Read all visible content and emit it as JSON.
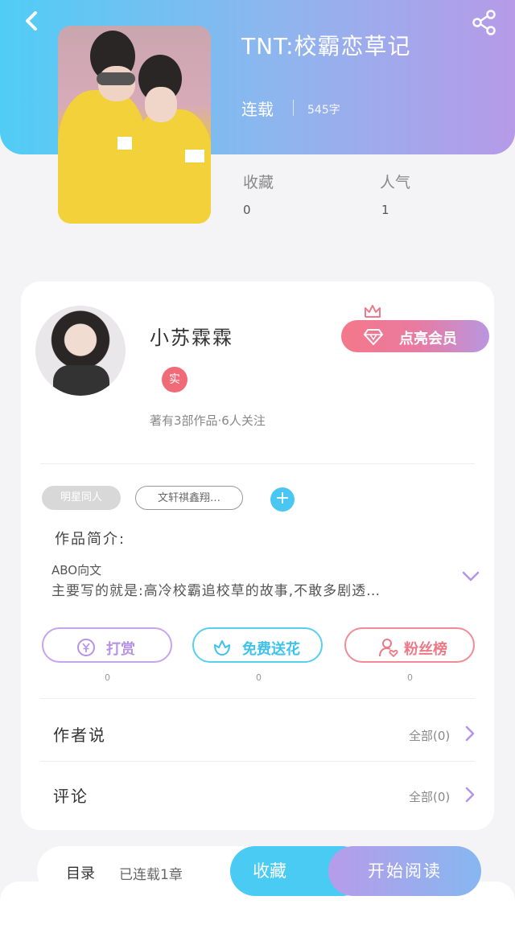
{
  "header": {
    "title": "TNT:校霸恋草记",
    "status": "连载",
    "word_count": "545字",
    "stats": [
      {
        "label": "收藏",
        "value": "0"
      },
      {
        "label": "人气",
        "value": "1"
      }
    ]
  },
  "author": {
    "name": "小苏霖霖",
    "badge": "实",
    "meta": "著有3部作品·6人关注",
    "vip_button": "点亮会员"
  },
  "tags": [
    "明星同人",
    "文轩祺鑫翔…"
  ],
  "intro": {
    "label": "作品简介:",
    "line1": "ABO向文",
    "line2": "主要写的就是:高冷校霸追校草的故事,不敢多剧透…"
  },
  "actions": [
    {
      "label": "打赏",
      "count": "0"
    },
    {
      "label": "免费送花",
      "count": "0"
    },
    {
      "label": "粉丝榜",
      "count": "0"
    }
  ],
  "sections": [
    {
      "title": "作者说",
      "link": "全部(0)"
    },
    {
      "title": "评论",
      "link": "全部(0)"
    }
  ],
  "bottom_bar": {
    "toc": "目录",
    "chapters": "已连载1章",
    "collect": "收藏",
    "read": "开始阅读"
  },
  "colors": {
    "header_gradient_start": "#50cdf5",
    "header_gradient_end": "#b69ae8",
    "accent_blue": "#49cbf3",
    "accent_pink": "#f06a78",
    "accent_purple": "#b693e6"
  }
}
